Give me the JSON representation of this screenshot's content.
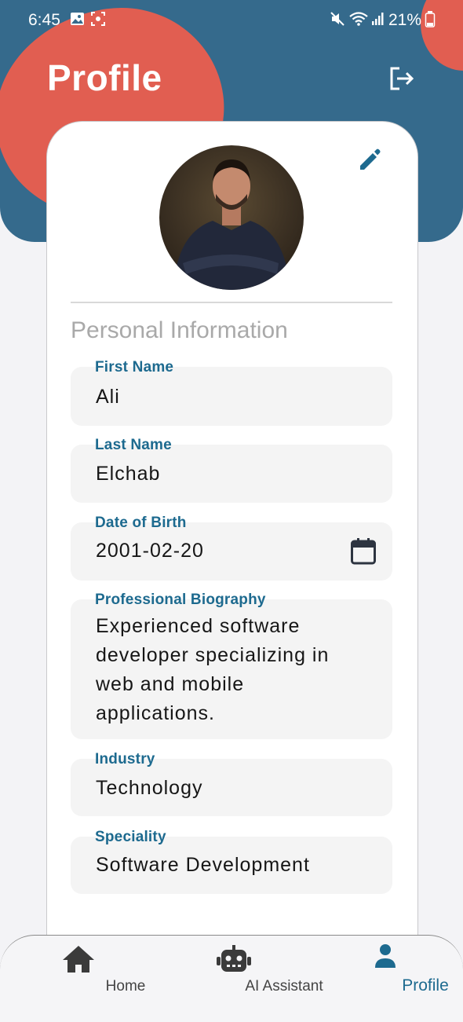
{
  "status_bar": {
    "time": "6:45",
    "battery": "21%"
  },
  "header": {
    "title": "Profile"
  },
  "profile": {
    "section_title": "Personal Information",
    "fields": [
      {
        "label": "First Name",
        "value": "Ali"
      },
      {
        "label": "Last Name",
        "value": "Elchab"
      },
      {
        "label": "Date of Birth",
        "value": "2001-02-20"
      },
      {
        "label": "Professional Biography",
        "value": "Experienced software developer specializing in web and mobile applications."
      },
      {
        "label": "Industry",
        "value": "Technology"
      },
      {
        "label": "Speciality",
        "value": "Software Development"
      }
    ]
  },
  "bottom_nav": {
    "items": [
      {
        "label": "Home",
        "icon": "home-icon"
      },
      {
        "label": "AI Assistant",
        "icon": "robot-icon"
      },
      {
        "label": "Profile",
        "icon": "person-icon",
        "active": true
      }
    ]
  },
  "colors": {
    "header_blue": "#356a8c",
    "accent_coral": "#e15e51",
    "label_blue": "#1d6a8f",
    "active_nav": "#1d6a8f"
  }
}
